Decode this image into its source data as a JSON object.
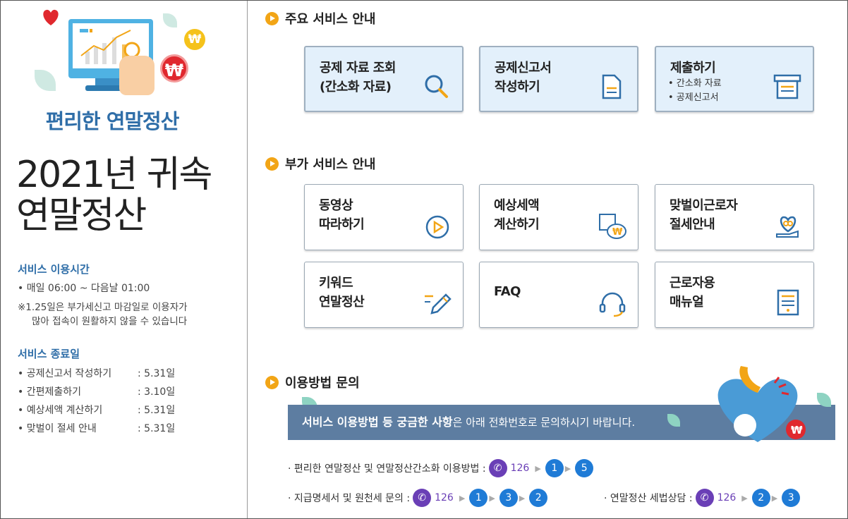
{
  "left": {
    "subtitle": "편리한 연말정산",
    "title_line1": "2021년 귀속",
    "title_line2": "연말정산",
    "hours_heading": "서비스 이용시간",
    "hours_line": "• 매일 06:00 ~ 다음날 01:00",
    "hours_note1": "※1.25일은 부가세신고 마감일로 이용자가",
    "hours_note2": "많아 접속이 원활하지 않을 수 있습니다",
    "end_heading": "서비스 종료일",
    "end_items": [
      {
        "label": "• 공제신고서 작성하기",
        "value": ": 5.31일"
      },
      {
        "label": "• 간편제출하기",
        "value": ": 3.10일"
      },
      {
        "label": "• 예상세액 계산하기",
        "value": ": 5.31일"
      },
      {
        "label": "• 맞벌이 절세 안내",
        "value": ": 5.31일"
      }
    ],
    "coin_symbol": "₩"
  },
  "main_services": {
    "heading": "주요 서비스 안내",
    "cards": [
      {
        "title": "공제 자료 조회\n(간소화 자료)",
        "icon": "search-icon"
      },
      {
        "title": "공제신고서\n작성하기",
        "icon": "document-icon"
      },
      {
        "title": "제출하기",
        "sub1": "• 간소화 자료",
        "sub2": "• 공제신고서",
        "icon": "submit-tray-icon"
      }
    ]
  },
  "extra_services": {
    "heading": "부가 서비스 안내",
    "cards": [
      {
        "title": "동영상\n따라하기",
        "icon": "play-icon"
      },
      {
        "title": "예상세액\n계산하기",
        "icon": "calculator-money-icon"
      },
      {
        "title": "맞벌이근로자\n절세안내",
        "icon": "heart-hand-icon"
      },
      {
        "title": "키워드\n연말정산",
        "icon": "pencil-icon"
      },
      {
        "title": "FAQ",
        "icon": "headset-icon"
      },
      {
        "title": "근로자용\n매뉴얼",
        "icon": "manual-icon"
      }
    ]
  },
  "inquiry": {
    "heading": "이용방법 문의",
    "banner_bold": "서비스 이용방법 등 궁금한 사항",
    "banner_rest": "은 아래 전화번호로 문의하시기 바랍니다.",
    "line1_label": "· 편리한 연말정산 및 연말정산간소화 이용방법 :",
    "line2_label": "· 지급명세서  및 원천세 문의 :",
    "line3_label": "· 연말정산 세법상담  :",
    "phone_number": "126",
    "line1_steps": [
      "1",
      "5"
    ],
    "line2_steps": [
      "1",
      "3",
      "2"
    ],
    "line3_steps": [
      "2",
      "3"
    ],
    "arrow": "▶"
  },
  "colors": {
    "accent_blue": "#2f6ea8",
    "orange": "#f2a516",
    "purple": "#6a3fb6",
    "step_blue": "#1f7bd6",
    "banner": "#5d7da1",
    "card_main_bg": "#e3f0fb"
  }
}
